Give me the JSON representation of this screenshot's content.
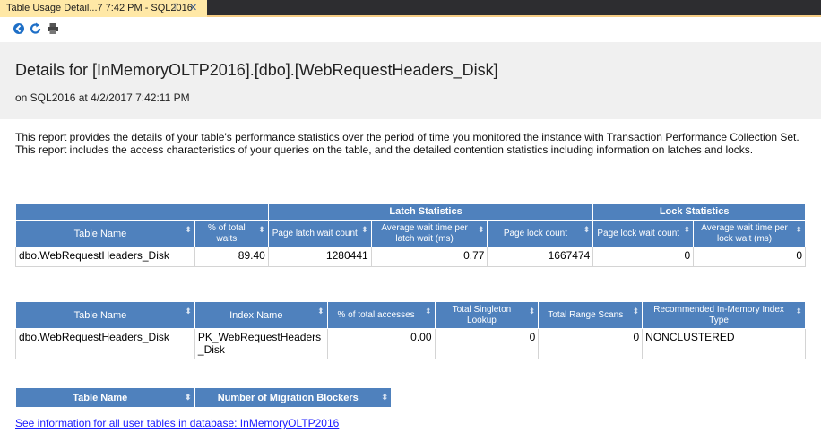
{
  "tab": {
    "title": "Table Usage Detail...7 7:42 PM - SQL2016",
    "pin_icon": "pin-icon",
    "close_icon": "close-icon"
  },
  "toolbar": {
    "icons": [
      "back-icon",
      "refresh-icon",
      "print-icon"
    ]
  },
  "header": {
    "title": "Details for [InMemoryOLTP2016].[dbo].[WebRequestHeaders_Disk]",
    "subtitle": "on SQL2016 at 4/2/2017 7:42:11 PM"
  },
  "description": "This report provides the details of your table's performance statistics over the period of time you monitored the instance with Transaction Performance Collection Set. This report includes the access characteristics of your queries on the table, and the detailed contention statistics including information on latches and locks.",
  "table1": {
    "group_latch": "Latch Statistics",
    "group_lock": "Lock Statistics",
    "columns": [
      "Table Name",
      "% of total waits",
      "Page latch wait count",
      "Average wait time per latch wait (ms)",
      "Page lock count",
      "Page lock wait count",
      "Average wait time per lock wait (ms)"
    ],
    "row": [
      "dbo.WebRequestHeaders_Disk",
      "89.40",
      "1280441",
      "0.77",
      "1667474",
      "0",
      "0"
    ]
  },
  "table2": {
    "columns": [
      "Table Name",
      "Index Name",
      "% of total accesses",
      "Total Singleton Lookup",
      "Total Range Scans",
      "Recommended In-Memory Index Type"
    ],
    "row": [
      "dbo.WebRequestHeaders_Disk",
      "PK_WebRequestHeaders_Disk",
      "0.00",
      "0",
      "0",
      "NONCLUSTERED"
    ]
  },
  "table3": {
    "columns": [
      "Table Name",
      "Number of Migration Blockers"
    ]
  },
  "footer_link": "See information for all user tables in database: InMemoryOLTP2016",
  "colors": {
    "header_blue": "#4f81bd",
    "tab_yellow": "#ffe8a6",
    "tabstrip_dark": "#2d2d30",
    "link": "#1a1aff"
  }
}
